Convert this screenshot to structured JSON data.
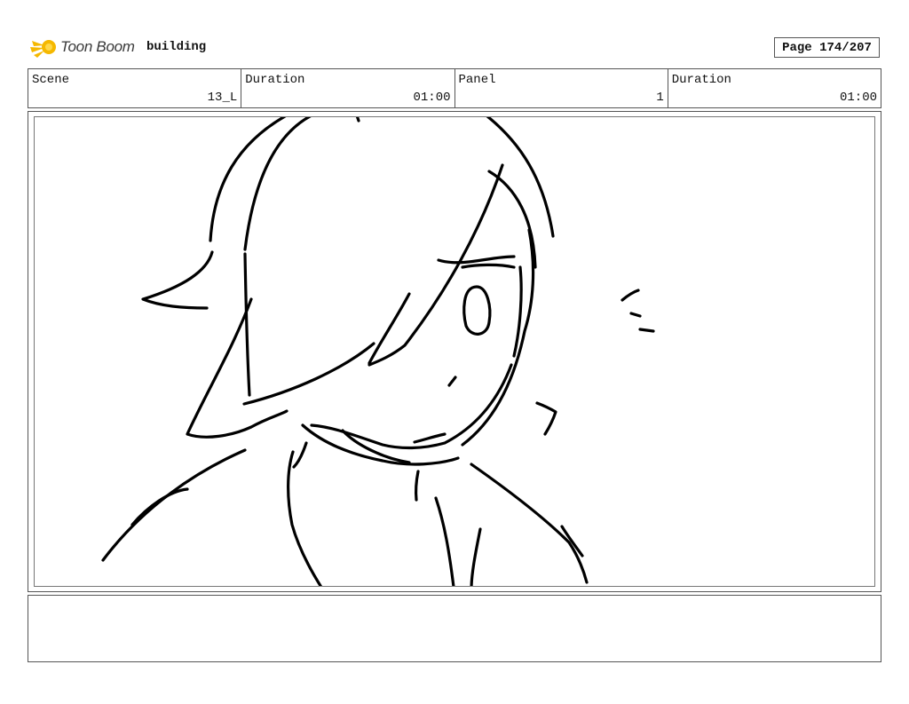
{
  "header": {
    "logo_text": "Toon Boom",
    "project_name": "building",
    "page_label": "Page 174/207"
  },
  "info": {
    "scene_label": "Scene",
    "scene_value": "13_L",
    "scene_duration_label": "Duration",
    "scene_duration_value": "01:00",
    "panel_label": "Panel",
    "panel_value": "1",
    "panel_duration_label": "Duration",
    "panel_duration_value": "01:00"
  },
  "colors": {
    "logo_accent": "#f5b800",
    "border": "#555555",
    "sketch_stroke": "#000000"
  },
  "panel": {
    "drawing": "character-sketch"
  },
  "notes": {
    "text": ""
  }
}
